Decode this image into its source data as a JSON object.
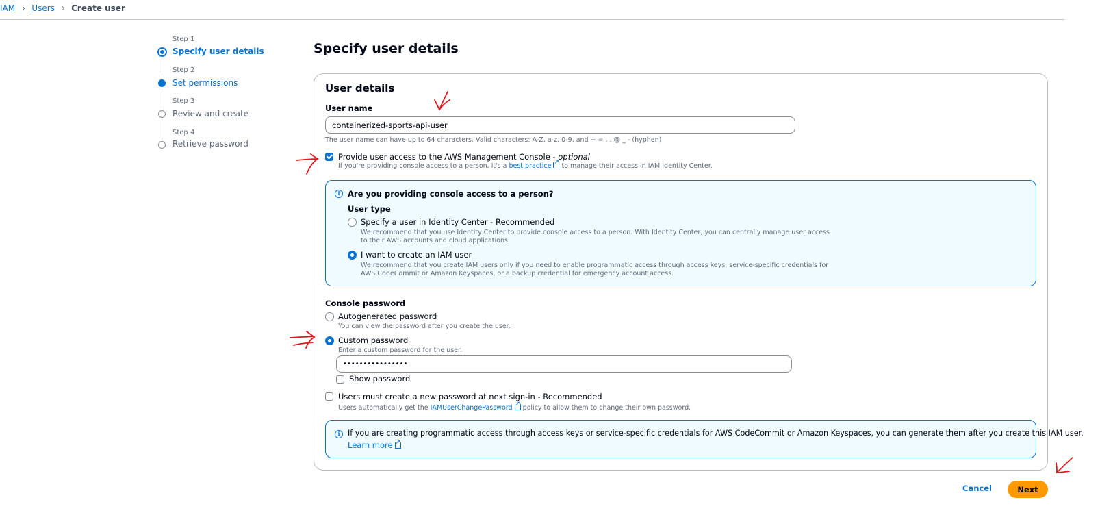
{
  "breadcrumb": {
    "items": [
      "IAM",
      "Users"
    ],
    "current": "Create user"
  },
  "steps": [
    {
      "step": "Step 1",
      "label": "Specify user details",
      "state": "current"
    },
    {
      "step": "Step 2",
      "label": "Set permissions",
      "state": "next"
    },
    {
      "step": "Step 3",
      "label": "Review and create",
      "state": "pending"
    },
    {
      "step": "Step 4",
      "label": "Retrieve password",
      "state": "pending"
    }
  ],
  "page_title": "Specify user details",
  "user_details": {
    "title": "User details",
    "username_label": "User name",
    "username_value": "containerized-sports-api-user",
    "username_hint": "The user name can have up to 64 characters. Valid characters: A-Z, a-z, 0-9, and + = , . @ _ - (hyphen)",
    "console_access_label": "Provide user access to the AWS Management Console - ",
    "console_access_optional": "optional",
    "console_access_checked": true,
    "console_hint_before": "If you're providing console access to a person, it's a ",
    "console_hint_link": "best practice",
    "console_hint_after": " to manage their access in IAM Identity Center."
  },
  "person_box": {
    "title": "Are you providing console access to a person?",
    "user_type_label": "User type",
    "option1_label": "Specify a user in Identity Center - Recommended",
    "option1_desc_1": "We recommend that you use Identity Center to provide console access to a person. With Identity Center, you can centrally manage user access",
    "option1_desc_2": "to their AWS accounts and cloud applications.",
    "option2_label": "I want to create an IAM user",
    "option2_desc_1": "We recommend that you create IAM users only if you need to enable programmatic access through access keys, service-specific credentials for",
    "option2_desc_2": "AWS CodeCommit or Amazon Keyspaces, or a backup credential for emergency account access.",
    "selected": "I want to create an IAM user"
  },
  "console_password": {
    "label": "Console password",
    "auto_label": "Autogenerated password",
    "auto_desc": "You can view the password after you create the user.",
    "custom_label": "Custom password",
    "custom_desc": "Enter a custom password for the user.",
    "selected": "Custom password",
    "password_value": "••••••••••••••••",
    "show_password_label": "Show password",
    "show_password_checked": false,
    "reset_label": "Users must create a new password at next sign-in - Recommended",
    "reset_checked": false,
    "reset_desc_before": "Users automatically get the ",
    "reset_desc_link": "IAMUserChangePassword",
    "reset_desc_after": " policy to allow them to change their own password."
  },
  "info_box": {
    "text": "If you are creating programmatic access through access keys or service-specific credentials for AWS CodeCommit or Amazon Keyspaces, you can generate them after you create this IAM user.",
    "link": "Learn more"
  },
  "actions": {
    "cancel": "Cancel",
    "next": "Next"
  },
  "colors": {
    "accent": "#0972d3",
    "primary_button": "#ff9900",
    "annotation": "#e0181b",
    "info_bg": "#f0fbff"
  },
  "icons": [
    "info-icon",
    "external-link-icon",
    "chevron-right-icon",
    "step-indicator-icon"
  ]
}
